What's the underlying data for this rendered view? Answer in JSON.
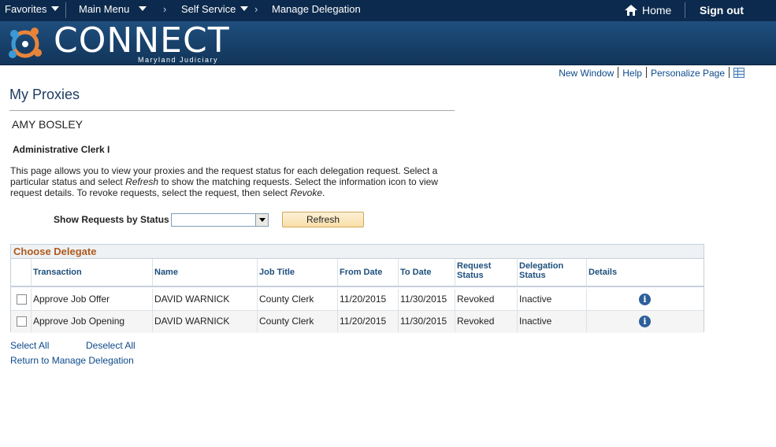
{
  "topnav": {
    "favorites": "Favorites",
    "main_menu": "Main Menu",
    "self_service": "Self Service",
    "current": "Manage Delegation",
    "home": "Home",
    "sign_out": "Sign out"
  },
  "banner": {
    "brand": "CONNECT",
    "subtitle": "Maryland Judiciary"
  },
  "pagelinks": {
    "new_window": "New Window",
    "help": "Help",
    "personalize": "Personalize Page"
  },
  "page": {
    "title": "My Proxies",
    "person_name": "AMY BOSLEY",
    "job_role": "Administrative Clerk I",
    "intro": {
      "p1": "This page allows you to view your proxies and the request status for each delegation request. Select a particular status and select ",
      "em1": "Refresh",
      "p2": " to show the matching requests. Select the information icon to view request details. To revoke requests, select the request, then select ",
      "em2": "Revoke",
      "p3": "."
    }
  },
  "filter": {
    "label": "Show Requests by Status",
    "selected": "",
    "refresh_label": "Refresh"
  },
  "grid": {
    "title": "Choose Delegate",
    "headers": {
      "transaction": "Transaction",
      "name": "Name",
      "job_title": "Job Title",
      "from_date": "From Date",
      "to_date": "To Date",
      "request_status_1": "Request",
      "request_status_2": "Status",
      "delegation_status_1": "Delegation",
      "delegation_status_2": "Status",
      "details": "Details"
    },
    "rows": [
      {
        "transaction": "Approve Job Offer",
        "name": "DAVID WARNICK",
        "job_title": "County Clerk",
        "from_date": "11/20/2015",
        "to_date": "11/30/2015",
        "request_status": "Revoked",
        "delegation_status": "Inactive",
        "details_icon": "i"
      },
      {
        "transaction": "Approve Job Opening",
        "name": "DAVID WARNICK",
        "job_title": "County Clerk",
        "from_date": "11/20/2015",
        "to_date": "11/30/2015",
        "request_status": "Revoked",
        "delegation_status": "Inactive",
        "details_icon": "i"
      }
    ]
  },
  "footer_links": {
    "select_all": "Select All",
    "deselect_all": "Deselect All",
    "return": "Return to Manage Delegation"
  }
}
